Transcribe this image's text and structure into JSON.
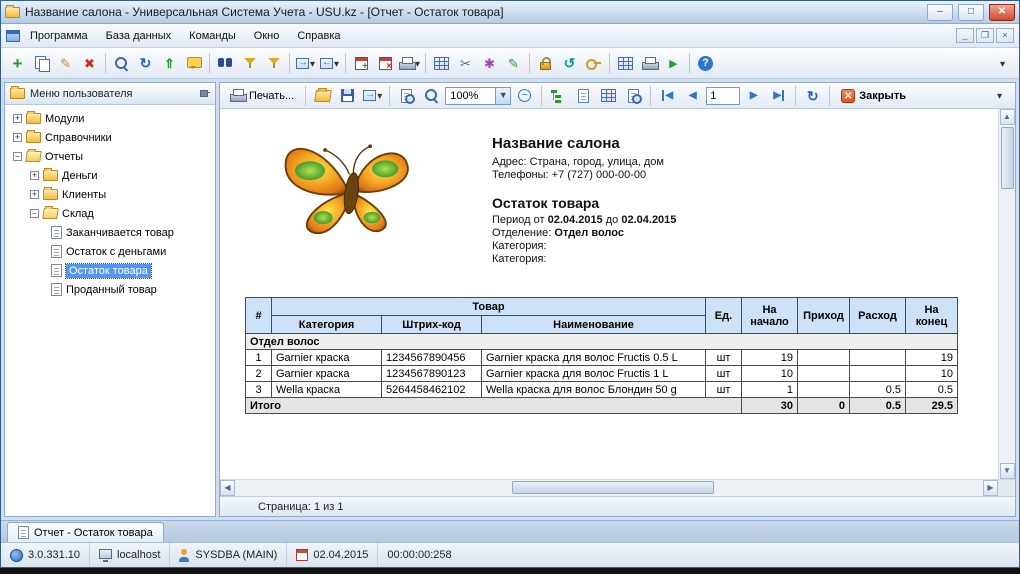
{
  "window": {
    "title": "Название салона - Универсальная Система Учета - USU.kz - [Отчет - Остаток товара]"
  },
  "menu": {
    "items": [
      {
        "label": "Программа"
      },
      {
        "label": "База данных"
      },
      {
        "label": "Команды"
      },
      {
        "label": "Окно"
      },
      {
        "label": "Справка"
      }
    ]
  },
  "toolbar": {
    "icons": [
      "add",
      "copy",
      "edit",
      "delete",
      "search",
      "refresh",
      "sort-up",
      "comment",
      "binoculars",
      "filter-raise",
      "filter-lower",
      "export",
      "import",
      "calendar-add",
      "calendar-remove",
      "print-settings",
      "grid",
      "cut",
      "wizard",
      "edit-data",
      "lock",
      "sync",
      "key",
      "table",
      "print",
      "run",
      "help"
    ]
  },
  "sidebar": {
    "title": "Меню пользователя",
    "items": [
      {
        "label": "Модули"
      },
      {
        "label": "Справочники"
      },
      {
        "label": "Отчеты"
      },
      {
        "label": "Деньги"
      },
      {
        "label": "Клиенты"
      },
      {
        "label": "Склад"
      },
      {
        "label": "Заканчивается товар"
      },
      {
        "label": "Остаток с деньгами"
      },
      {
        "label": "Остаток товара"
      },
      {
        "label": "Проданный товар"
      }
    ]
  },
  "report_toolbar": {
    "print_label": "Печать...",
    "zoom_value": "100%",
    "page_number": "1",
    "close_label": "Закрыть"
  },
  "report": {
    "salon_name": "Название салона",
    "address": "Адрес: Страна, город, улица, дом",
    "phones": "Телефоны: +7 (727) 000-00-00",
    "title": "Остаток товара",
    "period_label": "Период от",
    "period_from": "02.04.2015",
    "period_to_label": "до",
    "period_to": "02.04.2015",
    "department_label": "Отделение:",
    "department": "Отдел волос",
    "category_label_1": "Категория:",
    "category_label_2": "Категория:",
    "page_status": "Страница: 1 из 1",
    "table": {
      "headers": {
        "group": "Товар",
        "num": "#",
        "category": "Категория",
        "barcode": "Штрих-код",
        "name": "Наименование",
        "unit": "Ед.",
        "start": "На начало",
        "income": "Приход",
        "expense": "Расход",
        "end": "На конец"
      },
      "group_row": "Отдел волос",
      "rows": [
        {
          "num": "1",
          "category": "Garnier краска",
          "barcode": "1234567890456",
          "name": "Garnier краска для волос Fructis 0.5 L",
          "unit": "шт",
          "start": "19",
          "income": "",
          "expense": "",
          "end": "19"
        },
        {
          "num": "2",
          "category": "Garnier краска",
          "barcode": "1234567890123",
          "name": "Garnier краска для волос Fructis 1 L",
          "unit": "шт",
          "start": "10",
          "income": "",
          "expense": "",
          "end": "10"
        },
        {
          "num": "3",
          "category": "Wella краска",
          "barcode": "5264458462102",
          "name": "Wella краска для волос Блондин 50 g",
          "unit": "шт",
          "start": "1",
          "income": "",
          "expense": "0.5",
          "end": "0.5"
        }
      ],
      "total": {
        "label": "Итого",
        "start": "30",
        "income": "0",
        "expense": "0.5",
        "end": "29.5"
      }
    }
  },
  "bottom_tab": {
    "label": "Отчет - Остаток товара"
  },
  "status_bar": {
    "version": "3.0.331.10",
    "host": "localhost",
    "user": "SYSDBA (MAIN)",
    "date": "02.04.2015",
    "time": "00:00:00:258"
  }
}
